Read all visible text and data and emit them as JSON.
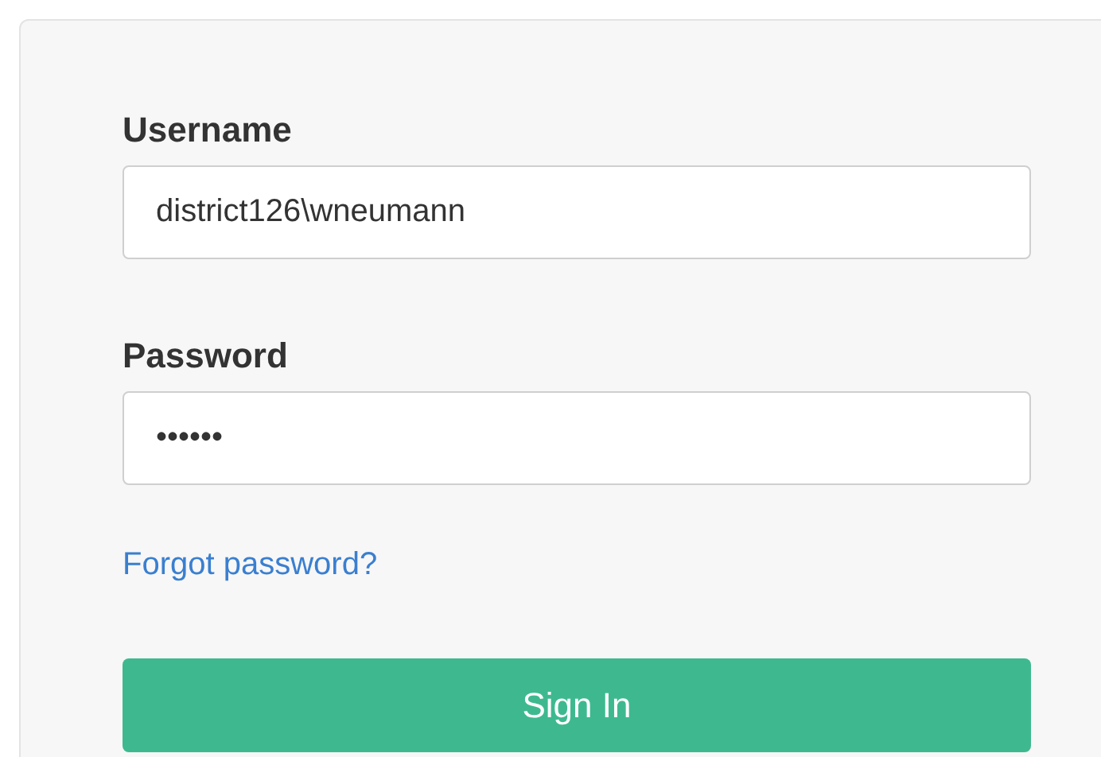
{
  "fields": [
    {
      "label": "Username",
      "value": "district126\\wneumann"
    },
    {
      "label": "Password",
      "value": "••••••"
    }
  ],
  "forgot_link": "Forgot password?",
  "submit_button": "Sign In"
}
